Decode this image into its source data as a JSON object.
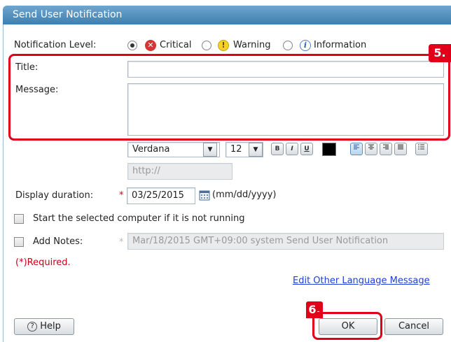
{
  "window": {
    "title": "Send User Notification"
  },
  "form": {
    "level_label": "Notification Level:",
    "levels": [
      {
        "label": "Critical",
        "icon": "critical-icon",
        "selected": true
      },
      {
        "label": "Warning",
        "icon": "warning-icon",
        "selected": false
      },
      {
        "label": "Information",
        "icon": "information-icon",
        "selected": false
      }
    ],
    "icon_glyphs": {
      "critical": "✕",
      "warning": "!",
      "info": "i"
    },
    "title_label": "Title:",
    "title_value": "",
    "message_label": "Message:",
    "message_value": "",
    "font": "Verdana",
    "font_size": "12",
    "format_buttons": [
      "B",
      "I",
      "U"
    ],
    "url_placeholder": "http://",
    "duration_label": "Display duration:",
    "required_mark": "*",
    "duration_value": "03/25/2015",
    "date_format": "(mm/dd/yyyy)",
    "start_computer_label": "Start the selected computer if it is not running",
    "add_notes_label": "Add Notes:",
    "notes_value": "Mar/18/2015 GMT+09:00 system Send User Notification",
    "required_note": "(*)Required.",
    "edit_link": "Edit Other Language Message"
  },
  "buttons": {
    "help": "Help",
    "help_glyph": "?",
    "ok": "OK",
    "cancel": "Cancel"
  },
  "callouts": {
    "step5": "5.",
    "step6": "6."
  },
  "colors": {
    "callout_red": "#e0001a",
    "titlebar": "#4f8cbd",
    "link": "#1f3fd6"
  }
}
